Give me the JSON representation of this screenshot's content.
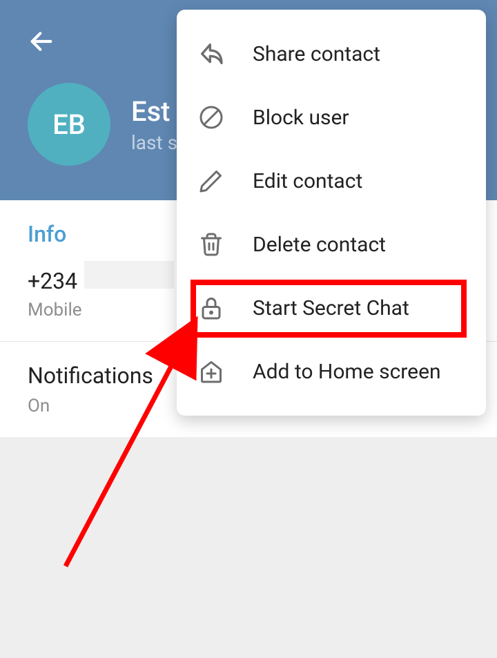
{
  "header": {
    "avatar_initials": "EB",
    "name": "Est",
    "status": "last s"
  },
  "info": {
    "section_label": "Info",
    "phone_prefix": "+234",
    "phone_type": "Mobile",
    "notifications_label": "Notifications",
    "notifications_status": "On"
  },
  "menu": {
    "items": [
      {
        "label": "Share contact"
      },
      {
        "label": "Block user"
      },
      {
        "label": "Edit contact"
      },
      {
        "label": "Delete contact"
      },
      {
        "label": "Start Secret Chat"
      },
      {
        "label": "Add to Home screen"
      }
    ]
  }
}
